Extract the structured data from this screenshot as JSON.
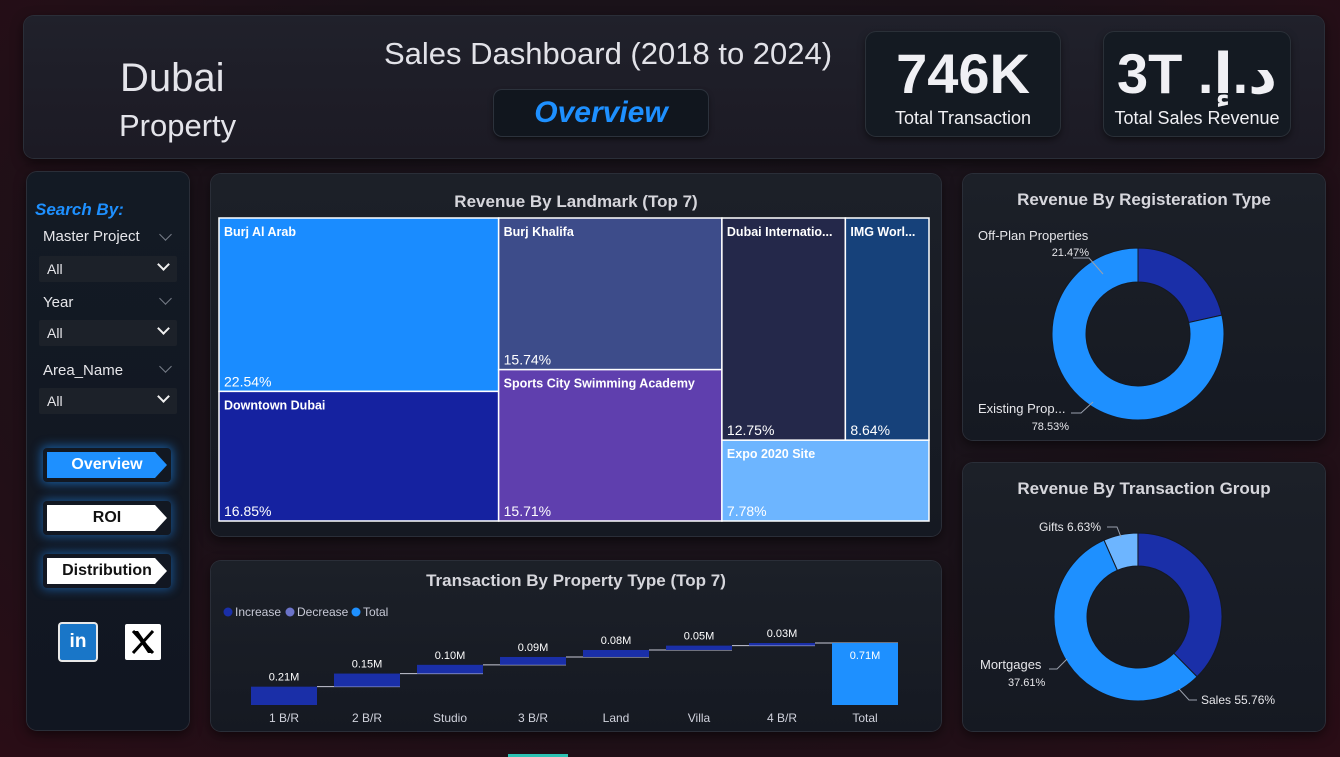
{
  "header": {
    "city": "Dubai",
    "subtitle": "Property",
    "title": "Sales Dashboard (2018 to 2024)",
    "page_label": "Overview",
    "kpis": [
      {
        "value": "746K",
        "label": "Total Transaction"
      },
      {
        "value": "3T د.إ.‏",
        "label": "Total Sales Revenue"
      }
    ]
  },
  "sidebar": {
    "search_by": "Search By:",
    "slicers": [
      {
        "label": "Master Project",
        "value": "All"
      },
      {
        "label": "Year",
        "value": "All"
      },
      {
        "label": "Area_Name",
        "value": "All"
      }
    ],
    "nav": [
      {
        "label": "Overview",
        "active": true
      },
      {
        "label": "ROI",
        "active": false
      },
      {
        "label": "Distribution",
        "active": false
      }
    ],
    "social": [
      {
        "icon": "linkedin-icon",
        "text": "in"
      },
      {
        "icon": "x-icon",
        "text": "𝕏"
      }
    ]
  },
  "colors": {
    "accent": "#1e90ff",
    "increase": "#1a2fa8",
    "decrease": "#6b73c9",
    "total": "#1e90ff"
  },
  "chart_data": [
    {
      "type": "treemap",
      "title": "Revenue By Landmark (Top 7)",
      "categories": [
        "Burj Al Arab",
        "Downtown Dubai",
        "Burj Khalifa",
        "Sports City Swimming Academy",
        "Dubai Internatio...",
        "IMG Worl...",
        "Expo 2020 Site"
      ],
      "labels": [
        "22.54%",
        "16.85%",
        "15.74%",
        "15.71%",
        "12.75%",
        "8.64%",
        "7.78%"
      ],
      "values": [
        22.54,
        16.85,
        15.74,
        15.71,
        12.75,
        8.64,
        7.78
      ],
      "colors": [
        "#1a8cff",
        "#1522a0",
        "#3d4c8a",
        "#5f3fae",
        "#24284a",
        "#16417a",
        "#6db5ff"
      ]
    },
    {
      "type": "waterfall",
      "title": "Transaction By Property Type (Top 7)",
      "legend": [
        "Increase",
        "Decrease",
        "Total"
      ],
      "categories": [
        "1 B/R",
        "2 B/R",
        "Studio",
        "3 B/R",
        "Land",
        "Villa",
        "4 B/R",
        "Total"
      ],
      "values": [
        0.21,
        0.15,
        0.1,
        0.09,
        0.08,
        0.05,
        0.03,
        0.71
      ],
      "labels": [
        "0.21M",
        "0.15M",
        "0.10M",
        "0.09M",
        "0.08M",
        "0.05M",
        "0.03M",
        "0.71M"
      ]
    },
    {
      "type": "pie",
      "title": "Revenue By Registeration Type",
      "categories": [
        "Off-Plan Properties",
        "Existing Prop..."
      ],
      "values": [
        21.47,
        78.53
      ],
      "labels": [
        "21.47%",
        "78.53%"
      ],
      "colors": [
        "#1a2fa8",
        "#1e90ff"
      ]
    },
    {
      "type": "pie",
      "title": "Revenue By Transaction Group",
      "categories": [
        "Gifts",
        "Mortgages",
        "Sales"
      ],
      "values": [
        6.63,
        37.61,
        55.76
      ],
      "labels": [
        "6.63%",
        "37.61%",
        "55.76%"
      ],
      "colors": [
        "#6db5ff",
        "#1a2fa8",
        "#1e90ff"
      ]
    }
  ]
}
